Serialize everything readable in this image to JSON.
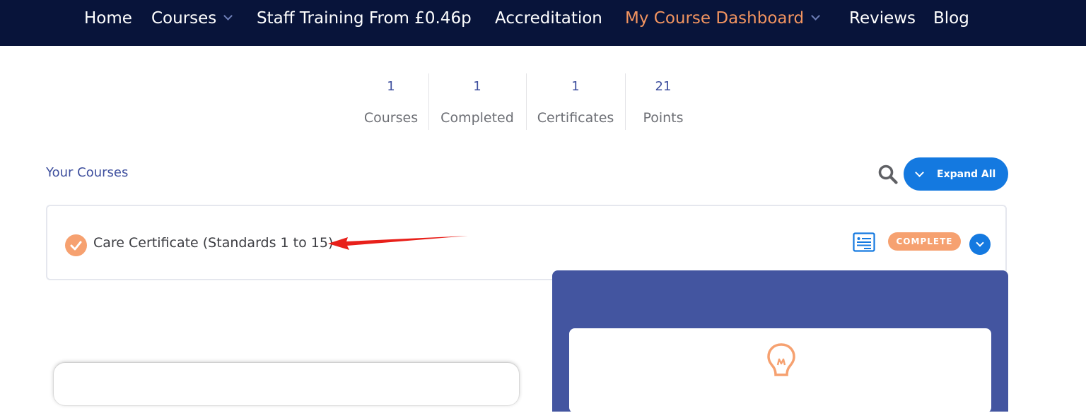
{
  "nav": {
    "items": [
      {
        "label": "Home"
      },
      {
        "label": "Courses"
      },
      {
        "label": "Staff Training From £0.46p"
      },
      {
        "label": "Accreditation"
      },
      {
        "label": "My Course Dashboard"
      },
      {
        "label": "Reviews"
      },
      {
        "label": "Blog"
      }
    ],
    "active_color": "#f29460",
    "background": "#08143a"
  },
  "stats": [
    {
      "value": "1",
      "label": "Courses"
    },
    {
      "value": "1",
      "label": "Completed"
    },
    {
      "value": "1",
      "label": "Certificates"
    },
    {
      "value": "21",
      "label": "Points"
    }
  ],
  "courses_header": {
    "title": "Your Courses",
    "expand_all_label": "Expand All"
  },
  "course": {
    "title": "Care Certificate (Standards 1 to 15)",
    "status": "COMPLETE"
  },
  "icons": {
    "search": "search-icon",
    "certificate": "certificate-icon",
    "check": "checkmark-icon",
    "bulb": "lightbulb-icon"
  },
  "colors": {
    "accent_blue": "#1479e0",
    "accent_orange": "#f6a170",
    "panel_blue": "#4355a0",
    "annotation_red": "#e8201a"
  }
}
